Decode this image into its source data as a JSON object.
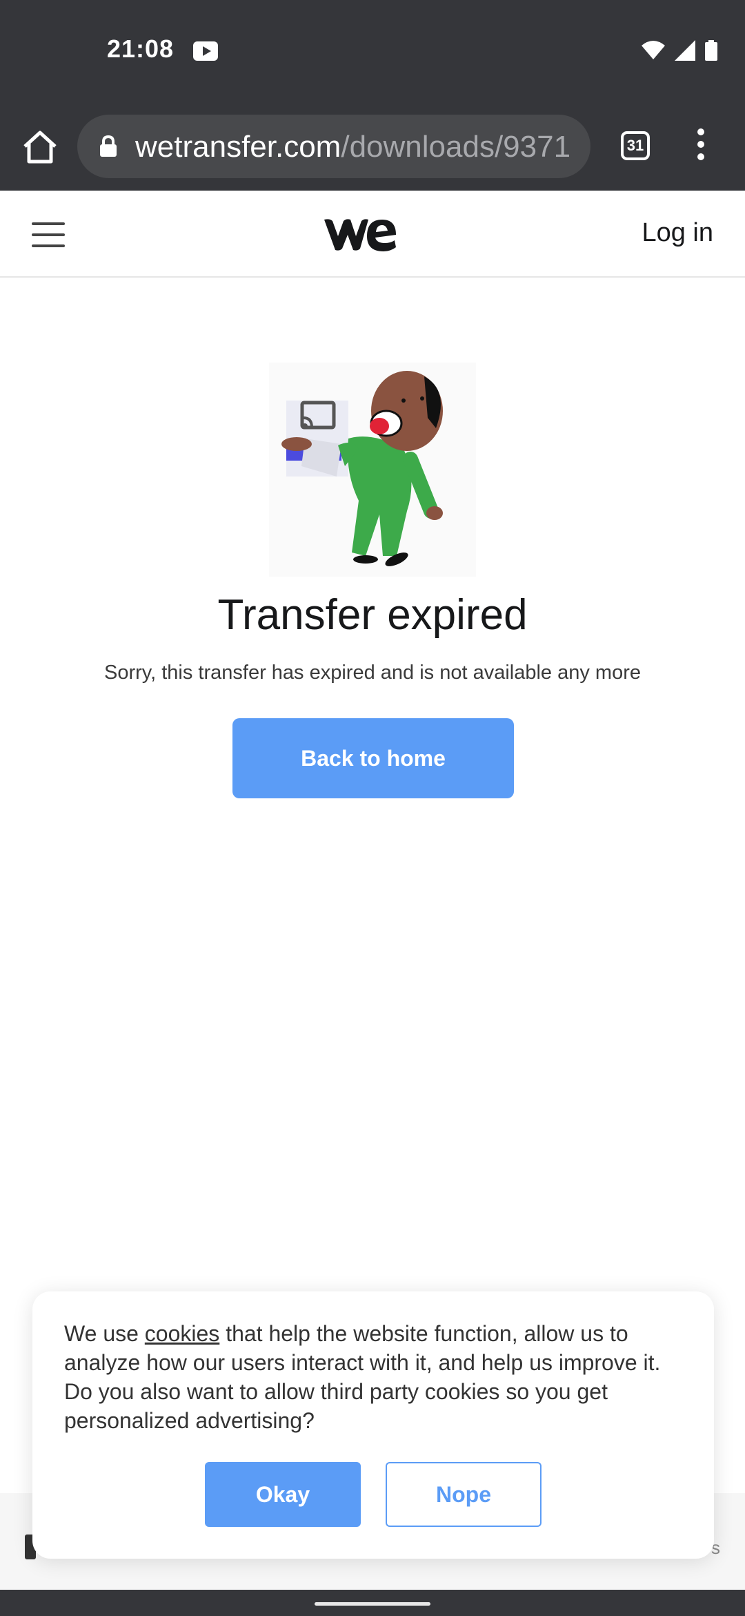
{
  "status_bar": {
    "time": "21:08",
    "icons": [
      "youtube-icon",
      "wifi-icon",
      "signal-icon",
      "battery-icon"
    ]
  },
  "browser": {
    "url_host": "wetransfer.com",
    "url_path": "/downloads/9371",
    "tab_count": "31"
  },
  "header": {
    "logo": "we",
    "login_label": "Log in"
  },
  "main": {
    "title": "Transfer expired",
    "message": "Sorry, this transfer has expired and is not available any more",
    "back_button": "Back to home"
  },
  "footer": {
    "right_text": "s"
  },
  "cookie_banner": {
    "text_before": "We use ",
    "link_text": "cookies",
    "text_after": " that help the website function, allow us to analyze how our users interact with it, and help us improve it. Do you also want to allow third party cookies so you get personalized advertising?",
    "okay_label": "Okay",
    "nope_label": "Nope"
  },
  "colors": {
    "accent": "#5b9cf6",
    "chrome": "#35363a"
  }
}
